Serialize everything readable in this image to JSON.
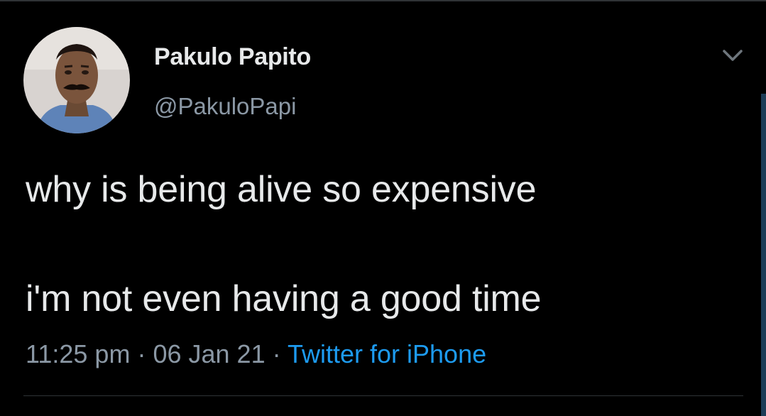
{
  "tweet": {
    "author": {
      "display_name": "Pakulo Papito",
      "handle": "@PakuloPapi"
    },
    "text_lines": [
      "why is being alive so expensive",
      "i'm not even having a good time"
    ],
    "time": "11:25 pm",
    "separator": "·",
    "date": "06 Jan 21",
    "source": "Twitter for iPhone",
    "menu_icon": "chevron-down-icon"
  },
  "colors": {
    "background": "#000000",
    "primary_text": "#e7e9ea",
    "secondary_text": "#8b98a5",
    "link": "#1d9bf0"
  }
}
